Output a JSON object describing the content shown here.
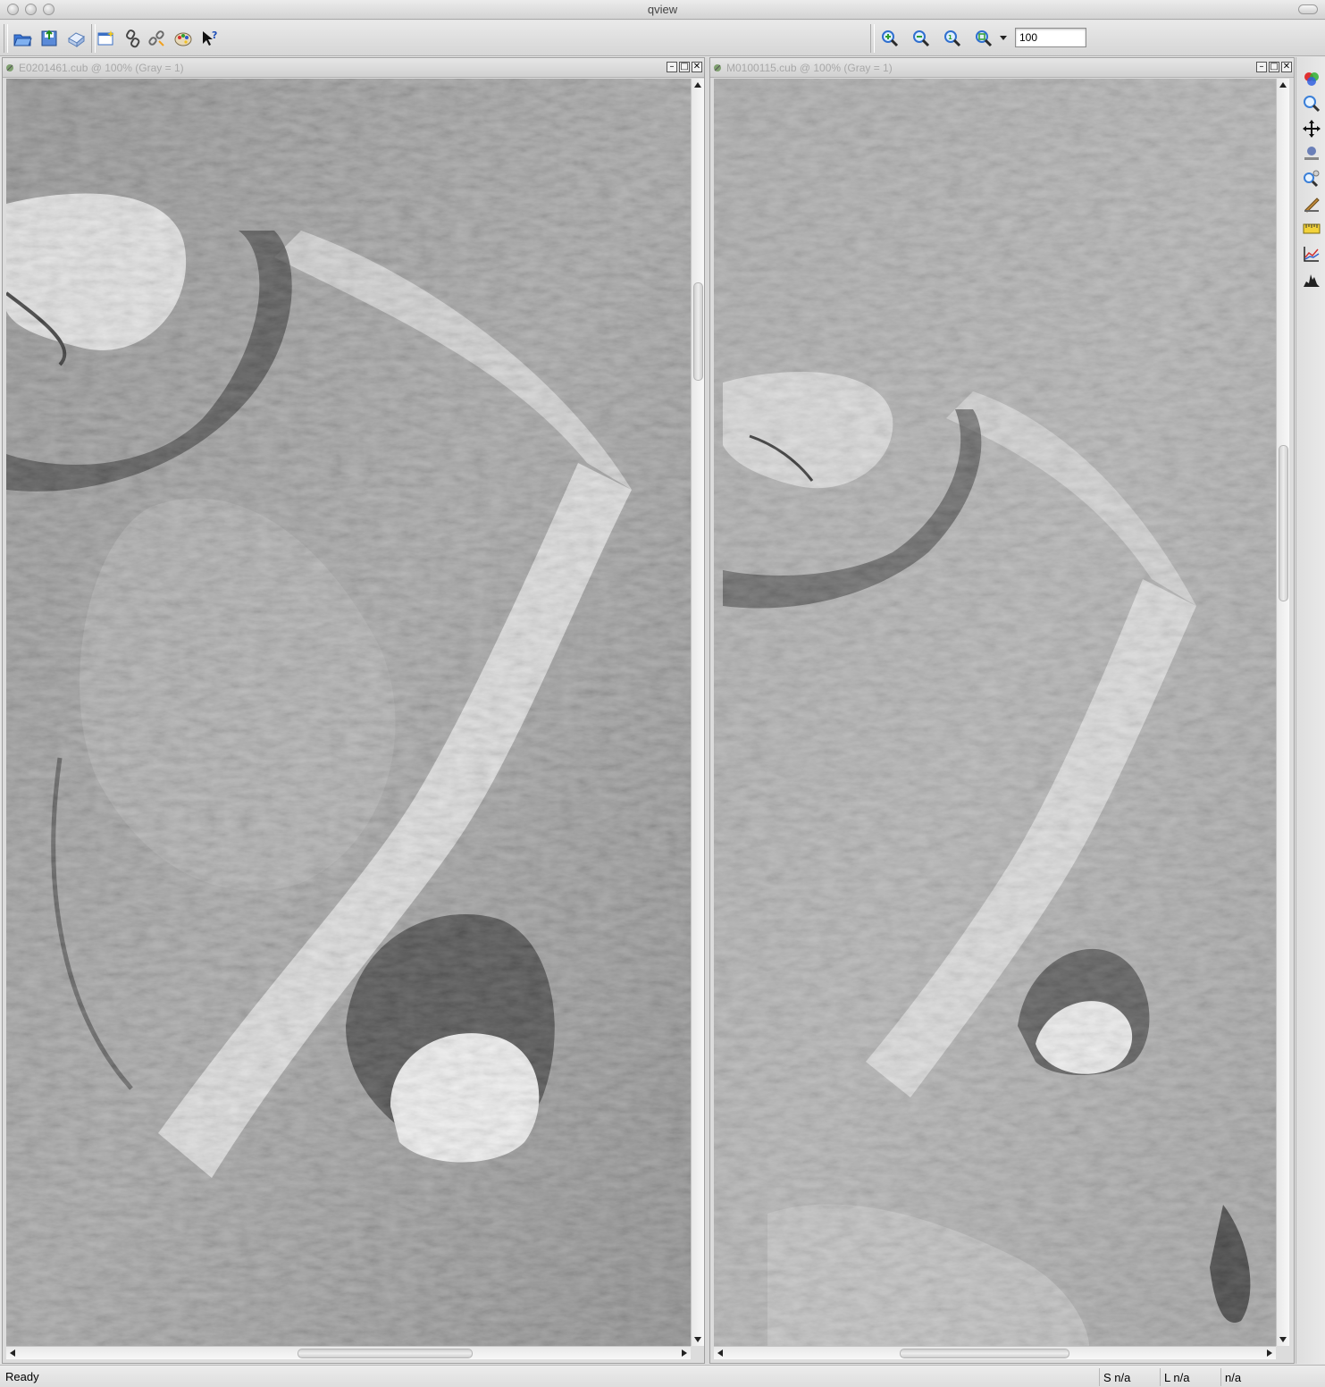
{
  "window": {
    "title": "qview"
  },
  "toolbar": {
    "file_tools": [
      "open-icon",
      "save-icon",
      "print-icon",
      "new-window-icon",
      "link-icon",
      "unlink-icon",
      "palette-icon",
      "whats-this-icon"
    ],
    "zoom_tools": [
      "zoom-in-icon",
      "zoom-out-icon",
      "zoom-actual-icon",
      "zoom-fit-icon"
    ],
    "zoom_value": "100"
  },
  "viewports": [
    {
      "title": "E0201461.cub @ 100% (Gray = 1)",
      "buttons": [
        "–",
        "□",
        "✕"
      ]
    },
    {
      "title": "M0100115.cub @ 100% (Gray = 1)",
      "buttons": [
        "–",
        "□",
        "✕"
      ]
    }
  ],
  "side_tools": [
    "band-select-icon",
    "zoom-tool-icon",
    "pan-tool-icon",
    "stretch-tool-icon",
    "find-tool-icon",
    "blink-tool-icon",
    "measure-tool-icon",
    "plot-tool-icon",
    "histogram-tool-icon"
  ],
  "status": {
    "message": "Ready",
    "sample": "S n/a",
    "line": "L n/a",
    "value": "n/a"
  },
  "colors": {
    "accent": "#1e5bd6",
    "zoom_green": "#2f9e2f",
    "image_gray": "#9c9c9c"
  }
}
